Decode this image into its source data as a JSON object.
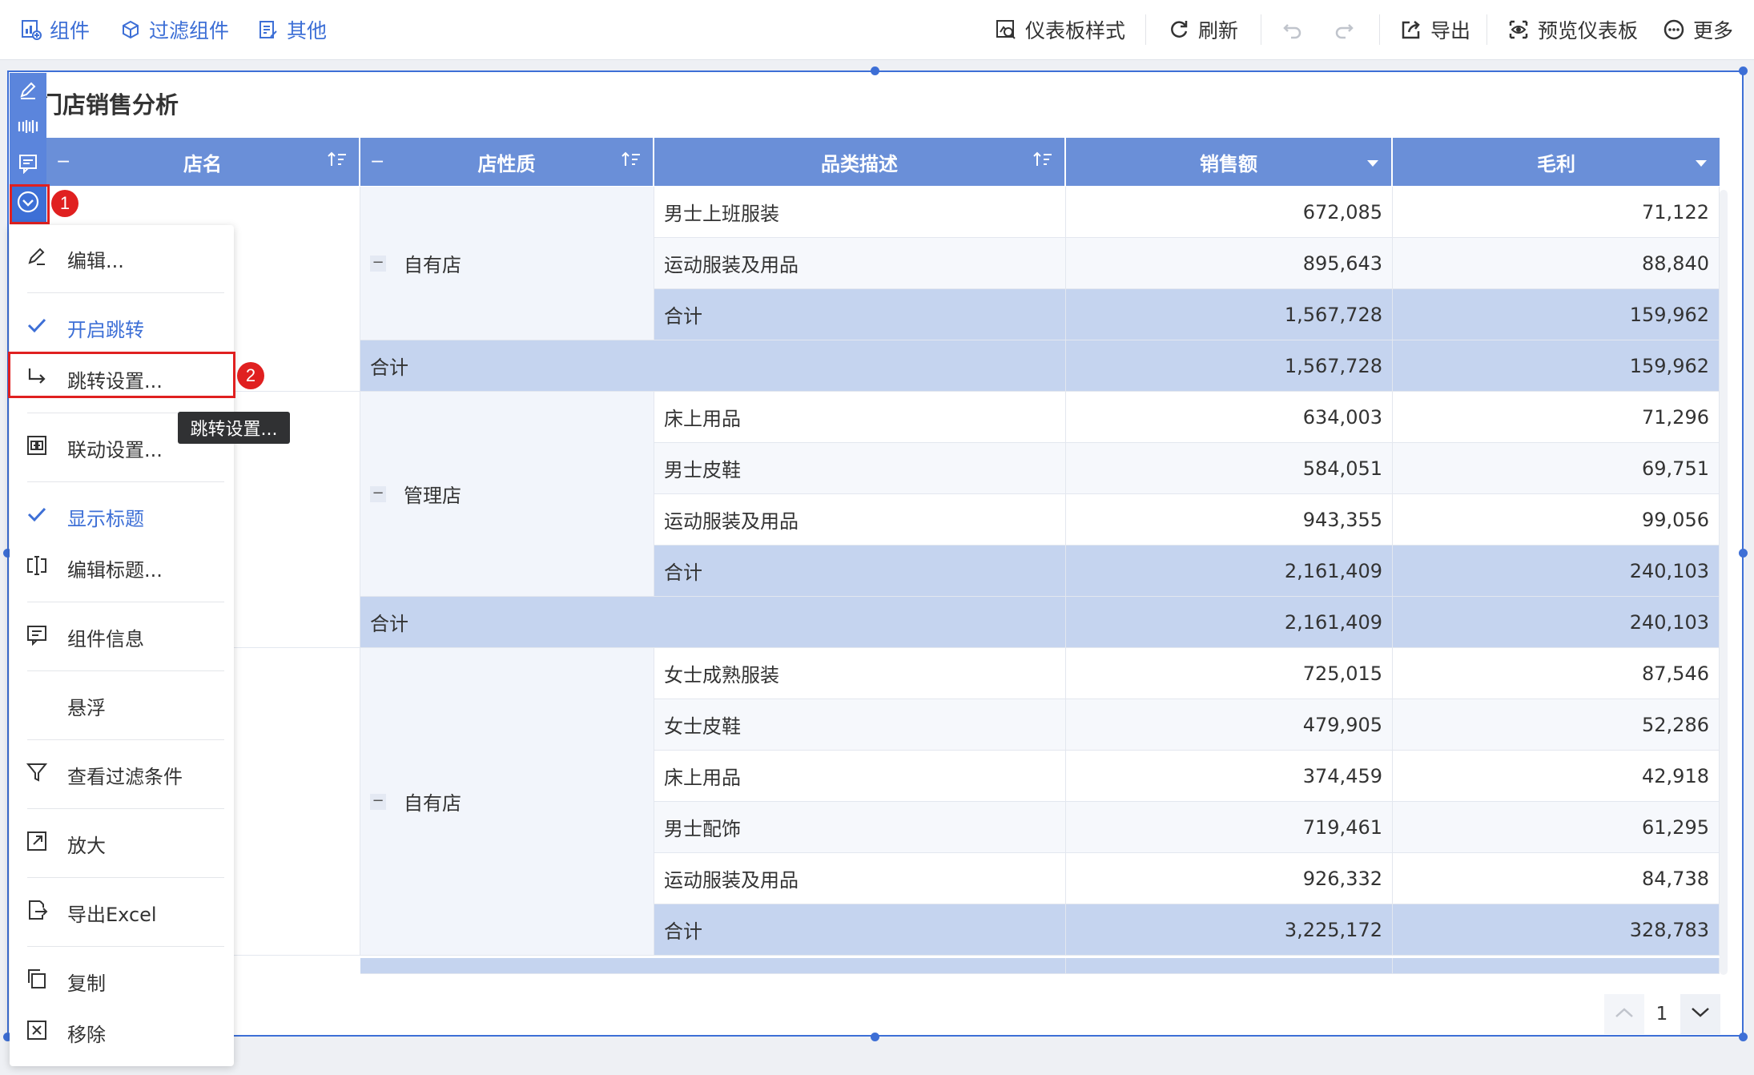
{
  "toolbar": {
    "left": [
      {
        "label": "组件",
        "icon": "chart-add-icon"
      },
      {
        "label": "过滤组件",
        "icon": "filter-cube-icon"
      },
      {
        "label": "其他",
        "icon": "doc-edit-icon"
      }
    ],
    "right": {
      "style": "仪表板样式",
      "refresh": "刷新",
      "export": "导出",
      "preview": "预览仪表板",
      "more": "更多"
    }
  },
  "widget": {
    "title": "门店销售分析",
    "title_visible": "门店销售分析"
  },
  "table": {
    "headers": [
      "店名",
      "店性质",
      "品类描述",
      "销售额",
      "毛利"
    ],
    "groups": [
      {
        "nature": "自有店",
        "rows": [
          {
            "category": "男士上班服装",
            "sales": "672,085",
            "profit": "71,122"
          },
          {
            "category": "运动服装及用品",
            "sales": "895,643",
            "profit": "88,840"
          },
          {
            "category": "合计",
            "sales": "1,567,728",
            "profit": "159,962"
          }
        ],
        "total": {
          "label": "合计",
          "sales": "1,567,728",
          "profit": "159,962"
        }
      },
      {
        "nature": "管理店",
        "rows": [
          {
            "category": "床上用品",
            "sales": "634,003",
            "profit": "71,296"
          },
          {
            "category": "男士皮鞋",
            "sales": "584,051",
            "profit": "69,751"
          },
          {
            "category": "运动服装及用品",
            "sales": "943,355",
            "profit": "99,056"
          },
          {
            "category": "合计",
            "sales": "2,161,409",
            "profit": "240,103"
          }
        ],
        "total": {
          "label": "合计",
          "sales": "2,161,409",
          "profit": "240,103"
        }
      },
      {
        "nature": "自有店",
        "rows": [
          {
            "category": "女士成熟服装",
            "sales": "725,015",
            "profit": "87,546"
          },
          {
            "category": "女士皮鞋",
            "sales": "479,905",
            "profit": "52,286"
          },
          {
            "category": "床上用品",
            "sales": "374,459",
            "profit": "42,918"
          },
          {
            "category": "男士配饰",
            "sales": "719,461",
            "profit": "61,295"
          },
          {
            "category": "运动服装及用品",
            "sales": "926,332",
            "profit": "84,738"
          },
          {
            "category": "合计",
            "sales": "3,225,172",
            "profit": "328,783"
          }
        ]
      }
    ]
  },
  "menu": {
    "items": [
      {
        "label": "编辑...",
        "icon": "pencil-icon",
        "checked": false
      },
      {
        "label": "开启跳转",
        "icon": "check-icon",
        "checked": true
      },
      {
        "label": "跳转设置...",
        "icon": "jump-arrow-icon",
        "checked": false
      },
      {
        "label": "联动设置...",
        "icon": "link-settings-icon",
        "checked": false
      },
      {
        "label": "显示标题",
        "icon": "check-icon",
        "checked": true
      },
      {
        "label": "编辑标题...",
        "icon": "title-edit-icon",
        "checked": false
      },
      {
        "label": "组件信息",
        "icon": "info-comment-icon",
        "checked": false
      },
      {
        "label": "悬浮",
        "icon": "",
        "checked": false
      },
      {
        "label": "查看过滤条件",
        "icon": "filter-icon",
        "checked": false
      },
      {
        "label": "放大",
        "icon": "expand-icon",
        "checked": false
      },
      {
        "label": "导出Excel",
        "icon": "export-file-icon",
        "checked": false
      },
      {
        "label": "复制",
        "icon": "copy-icon",
        "checked": false
      },
      {
        "label": "移除",
        "icon": "remove-box-icon",
        "checked": false
      }
    ]
  },
  "tooltip": "跳转设置...",
  "annotations": {
    "badge1": "1",
    "badge2": "2"
  },
  "pager": {
    "page": "1"
  },
  "colors": {
    "accent": "#3d6fd6",
    "header_bg": "#6a8fd8",
    "total_bg": "#c5d4ef",
    "highlight": "#e02020"
  }
}
